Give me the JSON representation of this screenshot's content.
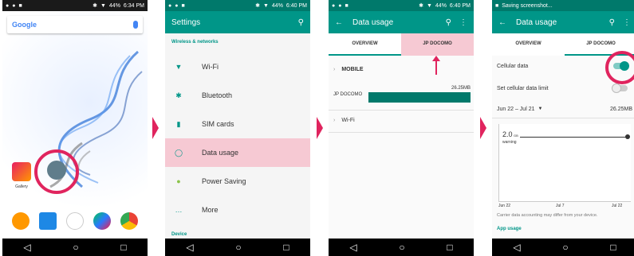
{
  "colors": {
    "accent": "#009688",
    "highlight": "#e0245e",
    "pink": "#f6c9d3"
  },
  "phone1": {
    "status_time": "6:34 PM",
    "status_battery": "44%",
    "search_logo": "Google",
    "gallery_label": "Gallery"
  },
  "phone2": {
    "status_time": "6:40 PM",
    "status_battery": "44%",
    "title": "Settings",
    "section": "Wireless & networks",
    "items": [
      {
        "label": "Wi-Fi",
        "icon": "wifi-icon"
      },
      {
        "label": "Bluetooth",
        "icon": "bluetooth-icon"
      },
      {
        "label": "SIM cards",
        "icon": "sim-icon"
      },
      {
        "label": "Data usage",
        "icon": "data-usage-icon"
      },
      {
        "label": "Power Saving",
        "icon": "power-icon"
      },
      {
        "label": "More",
        "icon": "more-icon"
      }
    ],
    "footer_section": "Device"
  },
  "phone3": {
    "status_time": "6:40 PM",
    "status_battery": "44%",
    "title": "Data usage",
    "tabs": [
      "OVERVIEW",
      "JP DOCOMO"
    ],
    "mobile_label": "MOBILE",
    "carrier": "JP DOCOMO",
    "usage": "26.25MB",
    "wifi_label": "Wi-Fi"
  },
  "phone4": {
    "status_text": "Saving screenshot...",
    "title": "Data usage",
    "tabs": [
      "OVERVIEW",
      "JP DOCOMO"
    ],
    "cellular_label": "Cellular data",
    "limit_label": "Set cellular data limit",
    "date_range": "Jun 22 – Jul 21",
    "usage": "26.25MB",
    "graph_value": "2.0",
    "graph_unit": "GB",
    "graph_warning": "warning",
    "x_labels": [
      "Jun 22",
      "Jul 7",
      "Jul 22"
    ],
    "note": "Carrier data accounting may differ from your device.",
    "app_usage": "App usage"
  }
}
